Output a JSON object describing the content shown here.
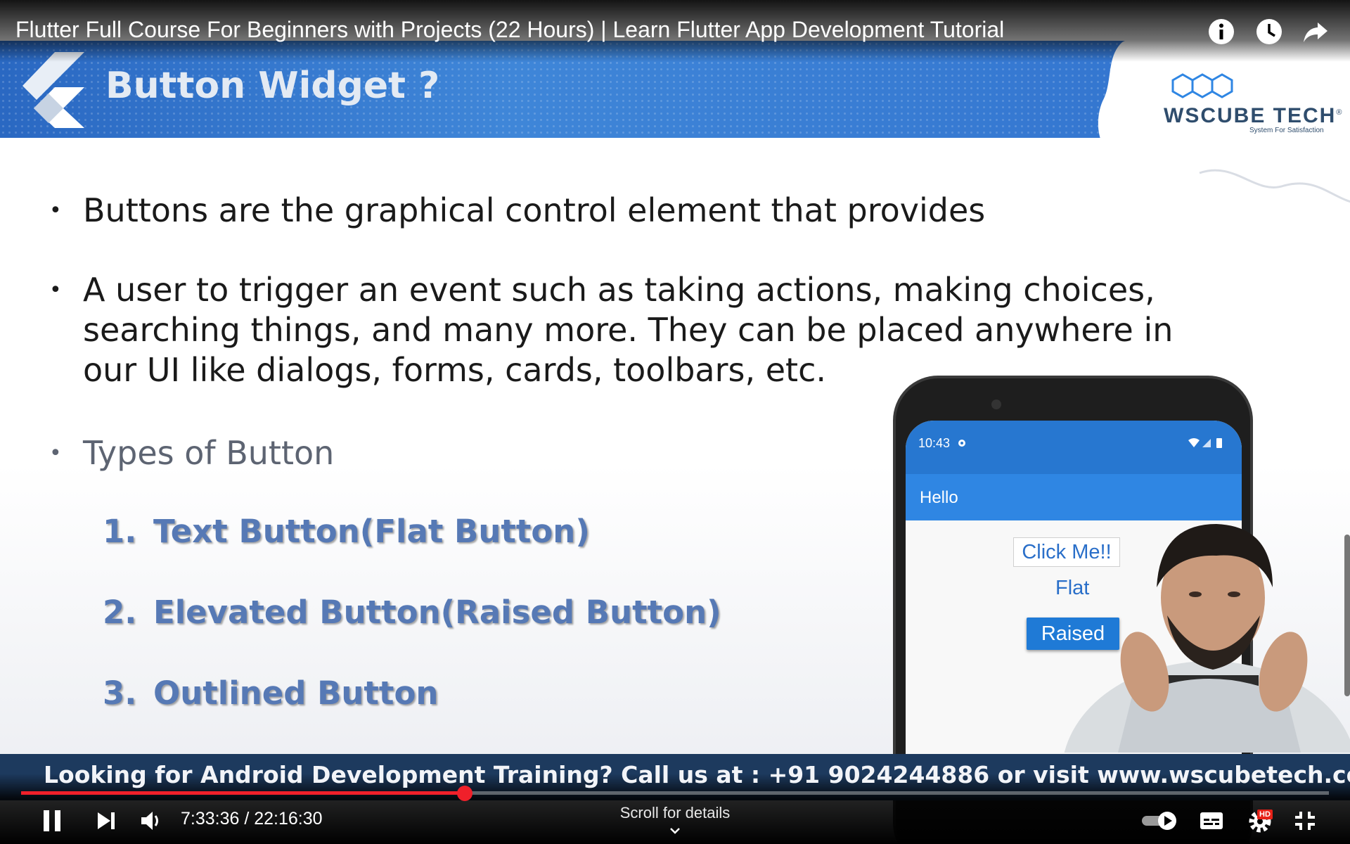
{
  "player": {
    "video_title": "Flutter Full Course For Beginners with Projects (22 Hours) | Learn Flutter App Development Tutorial",
    "current_time": "7:33:36",
    "duration": "22:16:30",
    "time_display": "7:33:36 / 22:16:30",
    "progress_fraction": 0.339,
    "scroll_hint": "Scroll for details",
    "quality_badge": "HD",
    "top_icons": [
      "info-icon",
      "watch-later-icon",
      "share-icon"
    ],
    "control_icons": [
      "pause-icon",
      "next-icon",
      "volume-icon",
      "autoplay-toggle-icon",
      "captions-icon",
      "settings-icon",
      "exit-fullscreen-icon"
    ]
  },
  "slide": {
    "title": "Button Widget ?",
    "logo": {
      "text": "WSCUBE TECH",
      "registered": "®",
      "tagline": "System For Satisfaction"
    },
    "bullets": [
      "Buttons are the graphical control element that provides",
      "A user to trigger an event such as taking actions, making choices, searching things, and many more. They can be placed anywhere in our UI like dialogs, forms, cards, toolbars, etc.",
      "Types of Button"
    ],
    "bullet_b2_lines": [
      "A user to trigger an event such as taking actions, making choices,",
      "searching things, and many more. They can be placed anywhere in",
      "our UI like dialogs, forms, cards, toolbars, etc."
    ],
    "types": [
      {
        "num": "1.",
        "label": "Text Button(Flat Button)"
      },
      {
        "num": "2.",
        "label": "Elevated Button(Raised Button)"
      },
      {
        "num": "3.",
        "label": "Outlined Button"
      }
    ],
    "phone": {
      "status_time": "10:43",
      "app_title": "Hello",
      "buttons": [
        "Click Me!!",
        "Flat",
        "Raised"
      ]
    },
    "banner": "Looking for Android Development Training? Call us at : +91 9024244886 or visit www.wscubetech.com"
  },
  "colors": {
    "header_blue": "#3476d0",
    "progress_red": "#f0202a",
    "type_text": "#5679b5",
    "banner_bg": "#1d3a5e"
  }
}
